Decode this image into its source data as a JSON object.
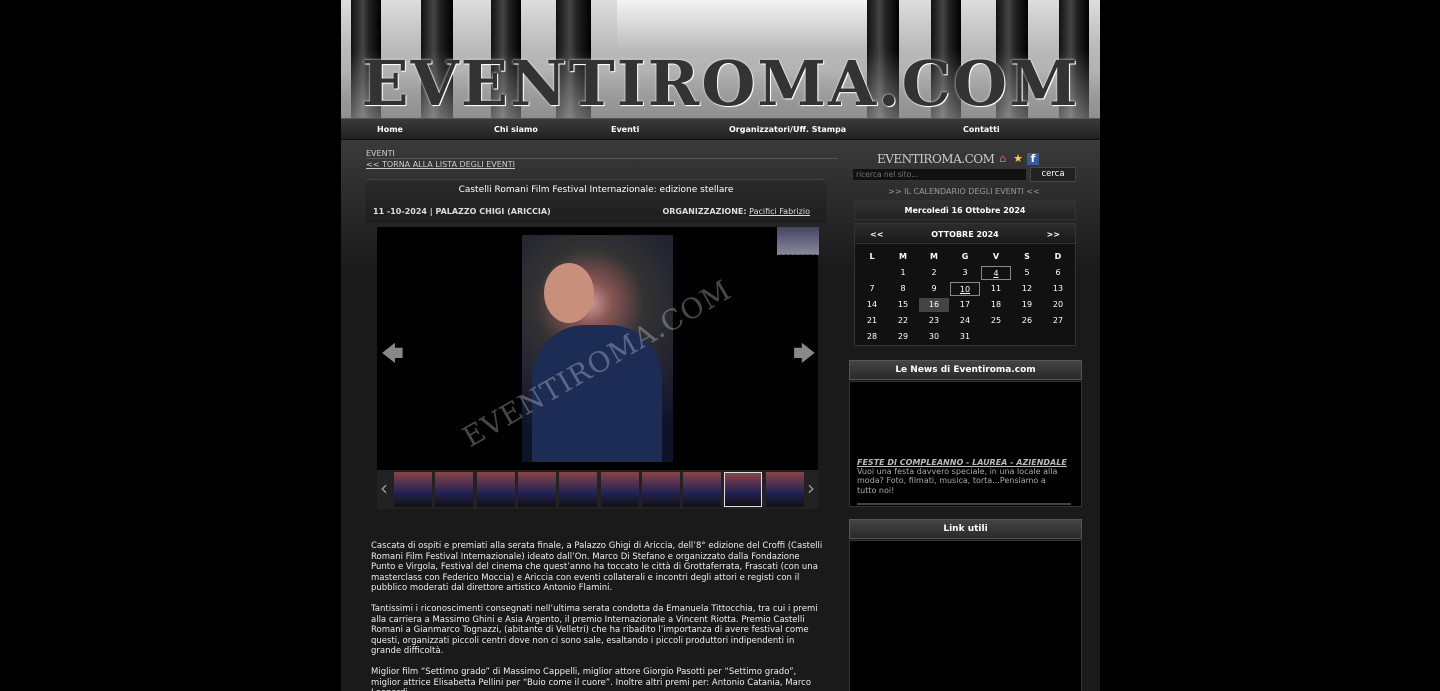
{
  "site": {
    "logo_text": "EVENTIROMA.COM",
    "mini_logo_text": "EVENTIROMA.COM"
  },
  "nav": {
    "items": [
      {
        "label": "Home"
      },
      {
        "label": "Chi siamo"
      },
      {
        "label": "Eventi"
      },
      {
        "label": "Organizzatori/Uff. Stampa"
      },
      {
        "label": "Contatti"
      }
    ]
  },
  "section": {
    "title": "EVENTI",
    "back_link": "<< TORNA ALLA LISTA DEGLI EVENTI"
  },
  "event": {
    "title": "Castelli Romani Film Festival Internazionale: edizione stellare",
    "date_location": "11 -10-2024  |  PALAZZO CHIGI (ARICCIA)",
    "org_label": "ORGANIZZAZIONE:",
    "org_name": "Pacifici Fabrizio"
  },
  "gallery": {
    "watermark": "EVENTIROMA.COM",
    "prev_arrow": "🡄",
    "next_arrow": "🡆",
    "strip_prev": "‹",
    "strip_next": "›",
    "thumb_count": 10,
    "active_thumb": 8
  },
  "article": {
    "paragraphs": [
      "Cascata di ospiti e premiati alla serata finale, a Palazzo Ghigi di Ariccia, dell’8° edizione del Croffi (Castelli Romani Film Festival Internazionale) ideato dall’On. Marco Di Stefano e organizzato dalla Fondazione Punto e Virgola, Festival del cinema che quest’anno ha toccato le città di Grottaferrata, Frascati (con una masterclass con Federico Moccia) e Ariccia con eventi collaterali e incontri degli attori e registi con il pubblico moderati dal direttore artistico Antonio Flamini.",
      "Tantissimi i riconoscimenti consegnati nell’ultima serata condotta da Emanuela Tittocchia, tra cui i premi alla carriera a Massimo Ghini e Asia Argento, il premio Internazionale a Vincent Riotta. Premio Castelli Romani a Gianmarco Tognazzi, (abitante di Velletri) che ha ribadito l’importanza di avere festival come questi, organizzati piccoli centri dove non ci sono sale, esaltando i piccoli produttori indipendenti in grande difficoltà.",
      "Miglior film “Settimo grado” di Massimo Cappelli, miglior attore Giorgio Pasotti per “Settimo grado”, miglior attrice Elisabetta Pellini per “Buio come il cuore”. Inoltre altri premi per: Antonio Catania, Marco Leonardi,"
    ]
  },
  "sidebar": {
    "search": {
      "placeholder": "ricerca nel sito...",
      "button": "cerca"
    },
    "calendar": {
      "link": ">> IL CALENDARIO DEGLI EVENTI <<",
      "today_label": "Mercoledì 16 Ottobre 2024",
      "prev": "<<",
      "next": ">>",
      "month": "OTTOBRE 2024",
      "weekdays": [
        "L",
        "M",
        "M",
        "G",
        "V",
        "S",
        "D"
      ],
      "weeks": [
        [
          "",
          "1",
          "2",
          "3",
          "4",
          "5",
          "6"
        ],
        [
          "7",
          "8",
          "9",
          "10",
          "11",
          "12",
          "13"
        ],
        [
          "14",
          "15",
          "16",
          "17",
          "18",
          "19",
          "20"
        ],
        [
          "21",
          "22",
          "23",
          "24",
          "25",
          "26",
          "27"
        ],
        [
          "28",
          "29",
          "30",
          "31",
          "",
          "",
          ""
        ]
      ],
      "today": "16",
      "marked_days": [
        "4",
        "10"
      ]
    },
    "news": {
      "header": "Le News di Eventiroma.com",
      "item_title": "FESTE DI COMPLEANNO - LAUREA - AZIENDALE",
      "item_text": "Vuoi una festa davvero speciale, in una locale alla moda? Foto, filmati, musica, torta...Pensiamo a tutto noi!"
    },
    "links": {
      "header": "Link utili"
    }
  }
}
